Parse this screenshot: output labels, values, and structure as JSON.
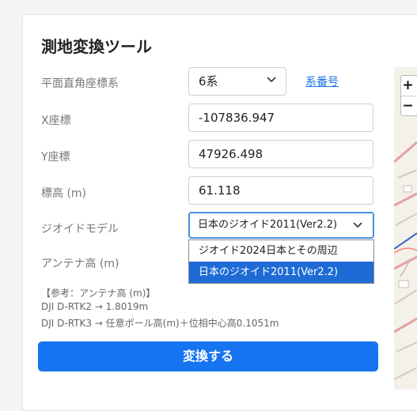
{
  "title": "測地変換ツール",
  "plane_system": {
    "label": "平面直角座標系",
    "value": "6系",
    "link": "系番号"
  },
  "x_coord": {
    "label": "X座標",
    "value": "-107836.947"
  },
  "y_coord": {
    "label": "Y座標",
    "value": "47926.498"
  },
  "elevation": {
    "label": "標高 (m)",
    "value": "61.118"
  },
  "geoid": {
    "label": "ジオイドモデル",
    "selected": "日本のジオイド2011(Ver2.2)",
    "options": [
      "ジオイド2024日本とその周辺",
      "日本のジオイド2011(Ver2.2)"
    ]
  },
  "antenna": {
    "label": "アンテナ高 (m)"
  },
  "notes": [
    "【参考：アンテナ高 (m)】",
    "DJI D-RTK2 → 1.8019m",
    "DJI D-RTK3 → 任意ポール高(m)＋位相中心高0.1051m"
  ],
  "submit_label": "変換する",
  "map": {
    "zoom_in": "+",
    "zoom_out": "−"
  },
  "colors": {
    "primary": "#1674f0",
    "link": "#1a73e8",
    "selected_option": "#1e6bd6"
  }
}
